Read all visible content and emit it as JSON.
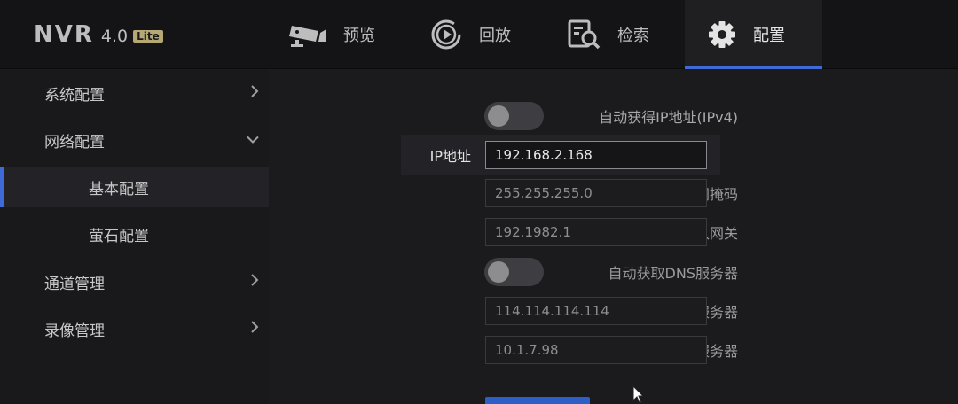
{
  "logo": {
    "name": "NVR",
    "version": "4.0",
    "edition": "Lite"
  },
  "tabs": [
    {
      "label": "预览",
      "icon": "camera-icon"
    },
    {
      "label": "回放",
      "icon": "playback-icon"
    },
    {
      "label": "检索",
      "icon": "search-document-icon"
    },
    {
      "label": "配置",
      "icon": "gear-icon",
      "active": true
    }
  ],
  "sidebar": {
    "items": [
      {
        "label": "系统配置",
        "icon": "chevron-right-icon"
      },
      {
        "label": "网络配置",
        "icon": "chevron-down-icon",
        "expanded": true
      },
      {
        "label": "基本配置",
        "active": true
      },
      {
        "label": "萤石配置"
      },
      {
        "label": "通道管理",
        "icon": "chevron-right-icon"
      },
      {
        "label": "录像管理",
        "icon": "chevron-right-icon"
      }
    ]
  },
  "form": {
    "dhcp": {
      "label": "自动获得IP地址(IPv4)",
      "on": false
    },
    "ip": {
      "label": "IP地址",
      "value": "192.168.2.168"
    },
    "mask": {
      "label": "子网掩码",
      "value": "255.255.255.0"
    },
    "gateway": {
      "label": "默认网关",
      "value": "192.1982.1"
    },
    "auto_dns": {
      "label": "自动获取DNS服务器",
      "on": false
    },
    "dns1": {
      "label": "首选DNS服务器",
      "value": "114.114.114.114"
    },
    "dns2": {
      "label": "备用DNS服务器",
      "value": "10.1.7.98"
    }
  },
  "colors": {
    "accent": "#3f6bd8",
    "background": "#1b1b1d",
    "topbar": "#141416"
  }
}
